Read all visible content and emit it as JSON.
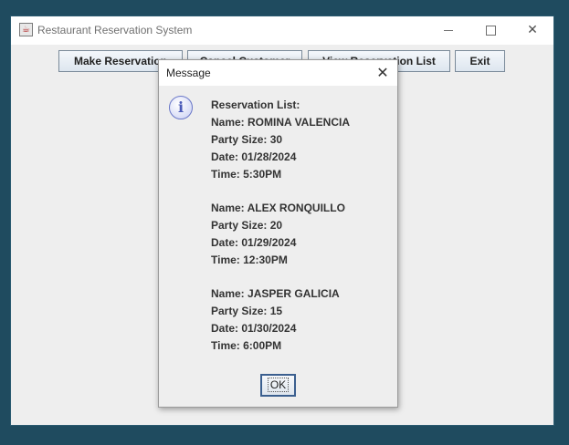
{
  "window": {
    "title": "Restaurant Reservation System",
    "controls": {
      "minimize": "—",
      "maximize": "☐",
      "close": "✕"
    }
  },
  "toolbar": {
    "make_label": "Make Reservation",
    "cancel_label": "Cancel Customer",
    "view_label": "View Reservation List",
    "exit_label": "Exit"
  },
  "dialog": {
    "title": "Message",
    "icon": "info-icon",
    "heading": "Reservation List:",
    "reservations": [
      {
        "name": "Name: ROMINA VALENCIA",
        "party": "Party Size: 30",
        "date": "Date: 01/28/2024",
        "time": "Time: 5:30PM"
      },
      {
        "name": "Name: ALEX RONQUILLO",
        "party": "Party Size: 20",
        "date": "Date: 01/29/2024",
        "time": "Time: 12:30PM"
      },
      {
        "name": "Name: JASPER GALICIA",
        "party": "Party Size: 15",
        "date": "Date: 01/30/2024",
        "time": "Time: 6:00PM"
      }
    ],
    "ok_label": "OK"
  }
}
